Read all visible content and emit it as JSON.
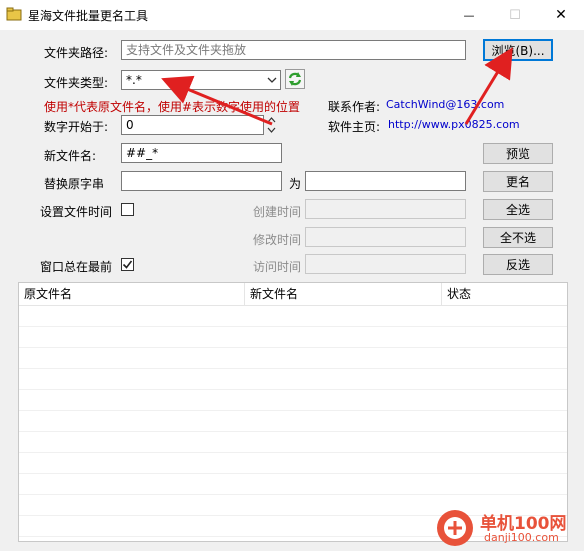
{
  "window": {
    "title": "星海文件批量更名工具",
    "minimize_glyph": "—",
    "maximize_glyph": "☐",
    "close_glyph": "✕"
  },
  "form": {
    "folder_path_label": "文件夹路径:",
    "folder_path_placeholder": "支持文件及文件夹拖放",
    "browse_label": "浏览(B)...",
    "folder_type_label": "文件夹类型:",
    "folder_type_value": "*.*",
    "hint": "使用*代表原文件名，使用#表示数字使用的位置",
    "number_start_label": "数字开始于:",
    "number_start_value": "0",
    "new_name_label": "新文件名:",
    "new_name_value": "##_*",
    "preview_label": "预览",
    "replace_label": "替换原字串",
    "replace_value": "",
    "for_label": "为",
    "replace_with_value": "",
    "rename_label": "更名",
    "set_time_label": "设置文件时间",
    "set_time_checked": false,
    "create_time_label": "创建时间",
    "modify_time_label": "修改时间",
    "access_time_label": "访问时间",
    "select_all_label": "全选",
    "select_none_label": "全不选",
    "invert_label": "反选",
    "always_on_top_label": "窗口总在最前",
    "always_on_top_checked": true
  },
  "contact": {
    "author_label": "联系作者:",
    "author_email": "CatchWind@163.com",
    "homepage_label": "软件主页:",
    "homepage_url": "http://www.px0825.com"
  },
  "table": {
    "columns": [
      "原文件名",
      "新文件名",
      "状态"
    ],
    "rows": []
  },
  "watermark": {
    "text": "单机100网",
    "url": "danji100.com"
  },
  "icons": {
    "refresh": "refresh-icon",
    "dropdown": "chevron-down-icon",
    "check": "check-icon"
  },
  "colors": {
    "hint": "#c00000",
    "link": "#0000cc",
    "annotation_arrow": "#e02020",
    "watermark": "#e8523a"
  }
}
